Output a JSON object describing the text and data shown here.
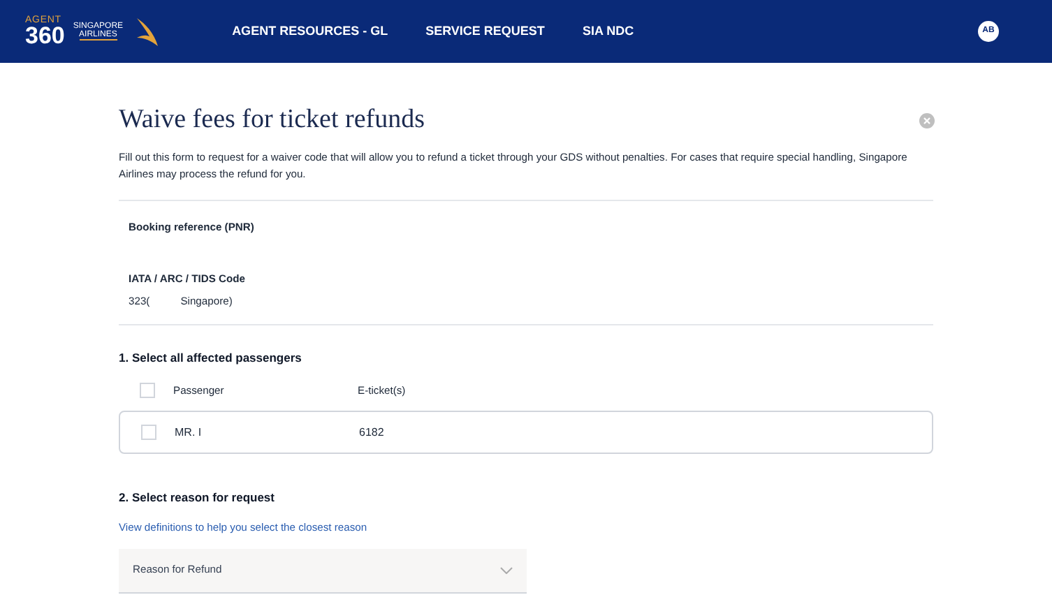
{
  "header": {
    "logo_top": "AGENT",
    "logo_number": "360",
    "logo_brand": "SINGAPORE",
    "logo_brand_sub": "AIRLINES",
    "nav": [
      {
        "label": "AGENT RESOURCES - GL"
      },
      {
        "label": "SERVICE REQUEST"
      },
      {
        "label": "SIA NDC"
      }
    ],
    "avatar": "AB"
  },
  "form": {
    "title": "Waive fees for ticket refunds",
    "description": "Fill out this form to request for a waiver code that will allow you to refund a ticket through your GDS without penalties. For cases that require special handling, Singapore Airlines may process the refund for you.",
    "booking_label": "Booking reference (PNR)",
    "iata_label": "IATA / ARC / TIDS Code",
    "iata_value_start": "323(",
    "iata_value_end": "Singapore)",
    "section_1": "1. Select all affected passengers",
    "columns": [
      "Passenger",
      "E-ticket(s)"
    ],
    "select_all_checked": false,
    "passengers": [
      {
        "name": "MR. I",
        "ticket": "6182",
        "checked": false
      }
    ],
    "section_2": "2. Select reason for request",
    "definitions_link": "View definitions to help you select the closest reason",
    "reason": {
      "placeholder": "Reason for Refund"
    }
  }
}
